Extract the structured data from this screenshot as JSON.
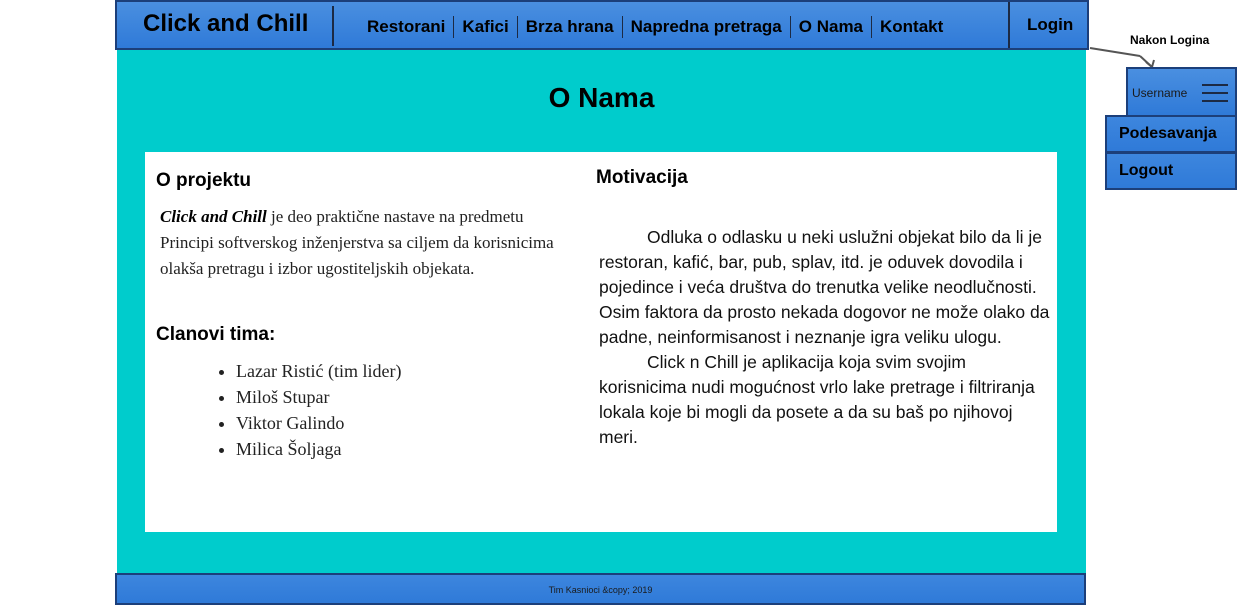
{
  "nav": {
    "brand": "Click and Chill",
    "links": [
      "Restorani",
      "Kafici",
      "Brza hrana",
      "Napredna pretraga",
      "O Nama",
      "Kontakt"
    ],
    "login": "Login"
  },
  "main": {
    "title": "O Nama",
    "project": {
      "heading": "O projektu",
      "brand_emphasis": "Click and Chill",
      "text": " je deo praktične nastave na predmetu Principi softverskog inženjerstva sa ciljem da korisnicima olakša pretragu i izbor ugostiteljskih objekata."
    },
    "team": {
      "heading": "Clanovi tima:",
      "members": [
        "Lazar Ristić (tim lider)",
        "Miloš Stupar",
        "Viktor Galindo",
        "Milica Šoljaga"
      ]
    },
    "motivation": {
      "heading": "Motivacija",
      "paragraphs": [
        "Odluka o odlasku u neki uslužni objekat bilo da li je restoran, kafić, bar, pub, splav, itd. je oduvek dovodila i pojedince i veća društva do trenutka velike neodlučnosti. Osim faktora da prosto nekada dogovor ne može olako da padne, neinformisanost i neznanje igra veliku ulogu.",
        "Click n Chill je aplikacija koja svim svojim korisnicima nudi mogućnost vrlo lake pretrage i filtriranja lokala koje bi mogli da posete a da su baš po njihovoj meri."
      ]
    }
  },
  "footer": {
    "text": "Tim Kasnioci &copy; 2019"
  },
  "annotation": {
    "label": "Nakon Logina",
    "username": "Username",
    "menu": [
      "Podesavanja",
      "Logout"
    ]
  },
  "colors": {
    "background": "#00cccc",
    "bar": "#2f7ad8",
    "bar_border": "#1c3f7a"
  }
}
